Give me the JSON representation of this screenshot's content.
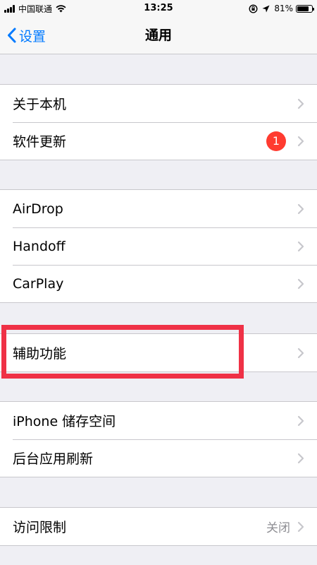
{
  "status_bar": {
    "carrier": "中国联通",
    "time": "13:25",
    "battery": "81%",
    "battery_level": 0.81
  },
  "nav": {
    "back_label": "设置",
    "title": "通用"
  },
  "groups": [
    [
      {
        "label": "关于本机"
      },
      {
        "label": "软件更新",
        "badge": "1"
      }
    ],
    [
      {
        "label": "AirDrop"
      },
      {
        "label": "Handoff"
      },
      {
        "label": "CarPlay"
      }
    ],
    [
      {
        "label": "辅助功能"
      }
    ],
    [
      {
        "label": "iPhone 储存空间"
      },
      {
        "label": "后台应用刷新"
      }
    ],
    [
      {
        "label": "访问限制",
        "value": "关闭"
      }
    ]
  ],
  "colors": {
    "accent": "#007aff",
    "badge": "#ff3b30",
    "highlight": "#ef3146"
  }
}
